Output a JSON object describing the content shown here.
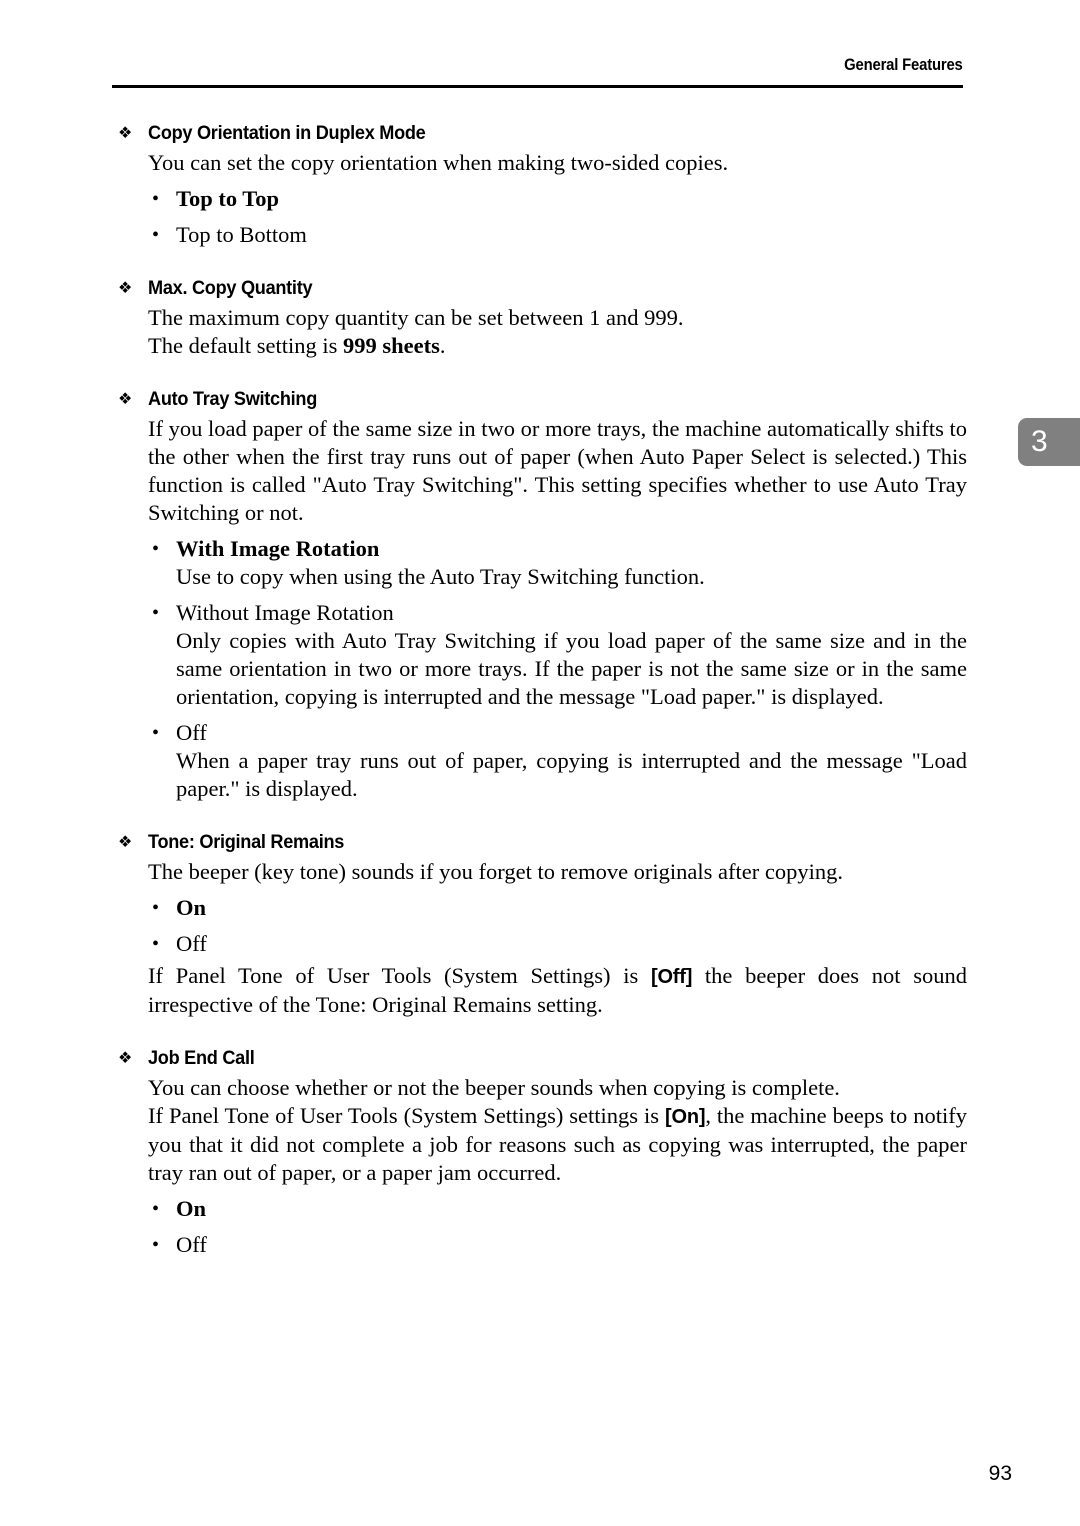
{
  "header": {
    "title": "General Features"
  },
  "chapter_tab": {
    "number": "3",
    "color": "#808080",
    "text_color": "#ffffff"
  },
  "icons": {
    "diamond_bullet": "❖",
    "round_bullet": "•"
  },
  "sections": [
    {
      "id": "copy-orientation-in-duplex-mode",
      "title": "Copy Orientation in Duplex Mode",
      "intro": "You can set the copy orientation when making two-sided copies.",
      "bullets": [
        {
          "label": "Top to Top",
          "bold": true,
          "body": ""
        },
        {
          "label": "Top to Bottom",
          "bold": false,
          "body": ""
        }
      ]
    },
    {
      "id": "max-copy-quantity",
      "title": "Max. Copy Quantity",
      "intro": "The maximum copy quantity can be set between 1 and 999.",
      "intro2_prefix": "The default setting is ",
      "intro2_bold": "999 sheets",
      "intro2_suffix": ".",
      "bullets": []
    },
    {
      "id": "auto-tray-switching",
      "title": "Auto Tray Switching",
      "intro": "If you load paper of the same size in two or more trays, the machine automatically shifts to the other when the first tray runs out of paper (when Auto Paper Select is selected.) This function is called \"Auto Tray Switching\". This setting specifies whether to use Auto Tray Switching or not.",
      "bullets": [
        {
          "label": "With Image Rotation",
          "bold": true,
          "body": "Use to copy when using the Auto Tray Switching function."
        },
        {
          "label": "Without Image Rotation",
          "bold": false,
          "body": "Only copies with Auto Tray Switching if you load paper of the same size and in the same orientation in two or more trays. If the paper is not the same size or in the same orientation, copying is interrupted and the message \"Load paper.\" is displayed."
        },
        {
          "label": "Off",
          "bold": false,
          "body": "When a paper tray runs out of paper, copying is interrupted and the message \"Load paper.\" is displayed."
        }
      ]
    },
    {
      "id": "tone-original-remains",
      "title": "Tone: Original Remains",
      "intro": "The beeper (key tone) sounds if you forget to remove originals after copying.",
      "bullets": [
        {
          "label": "On",
          "bold": true,
          "body": ""
        },
        {
          "label": "Off",
          "bold": false,
          "body": ""
        }
      ],
      "outro_prefix": "If Panel Tone of User Tools (System Settings) is ",
      "outro_key": "[Off]",
      "outro_suffix": " the beeper does not sound irrespective of the Tone: Original Remains setting."
    },
    {
      "id": "job-end-call",
      "title": "Job End Call",
      "intro": "You can choose whether or not the beeper sounds when copying is complete.",
      "intro2_prefix": "If Panel Tone of User Tools (System Settings) settings is ",
      "intro2_key": "[On]",
      "intro2_suffix": ", the machine beeps to notify you that it did not complete a job for reasons such as copying was interrupted, the paper tray ran out of paper, or a paper jam occurred.",
      "bullets": [
        {
          "label": "On",
          "bold": true,
          "body": ""
        },
        {
          "label": "Off",
          "bold": false,
          "body": ""
        }
      ]
    }
  ],
  "folio": {
    "page_number": "93"
  }
}
